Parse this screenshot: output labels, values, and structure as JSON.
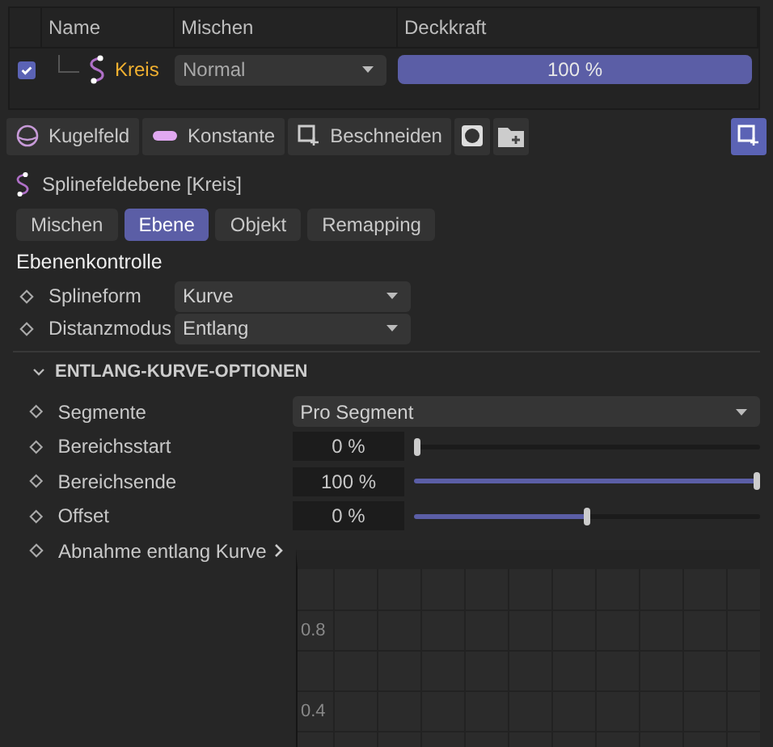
{
  "layers": {
    "columns": [
      "Name",
      "Mischen",
      "Deckkraft"
    ],
    "rows": [
      {
        "checked": true,
        "name": "Kreis",
        "blend": "Normal",
        "opacity": "100 %",
        "level": 1
      }
    ]
  },
  "toolbar": [
    {
      "kind": "sphere",
      "label": "Kugelfeld"
    },
    {
      "kind": "constant",
      "label": "Konstante"
    },
    {
      "kind": "clip",
      "label": "Beschneiden"
    },
    {
      "kind": "record"
    },
    {
      "kind": "folder"
    }
  ],
  "toolbar_right": {
    "on": true
  },
  "panel": {
    "title": "Splinefeldebene [Kreis]"
  },
  "tabs": [
    {
      "label": "Mischen",
      "selected": false
    },
    {
      "label": "Ebene",
      "selected": true
    },
    {
      "label": "Objekt",
      "selected": false
    },
    {
      "label": "Remapping",
      "selected": false
    }
  ],
  "section": {
    "title": "Ebenenkontrolle",
    "params": [
      {
        "kind": "dropdown",
        "label": "Splineform",
        "value": "Kurve"
      },
      {
        "kind": "dropdown",
        "label": "Distanzmodus",
        "value": "Entlang"
      }
    ]
  },
  "group": {
    "title": "ENTLANG-KURVE-OPTIONEN",
    "expanded": true,
    "params": [
      {
        "kind": "dropdown",
        "label": "Segmente",
        "value": "Pro Segment"
      },
      {
        "kind": "slider",
        "label": "Bereichsstart",
        "value": "0 %",
        "level": 0
      },
      {
        "kind": "slider",
        "label": "Bereichsende",
        "value": "100 %",
        "level": 1
      },
      {
        "kind": "slider",
        "label": "Offset",
        "value": "0 %",
        "level": 0.5
      },
      {
        "kind": "curve",
        "label": "Abnahme entlang Kurve",
        "expanded": false,
        "y_labels": [
          "0.8",
          "0.4"
        ]
      }
    ]
  }
}
